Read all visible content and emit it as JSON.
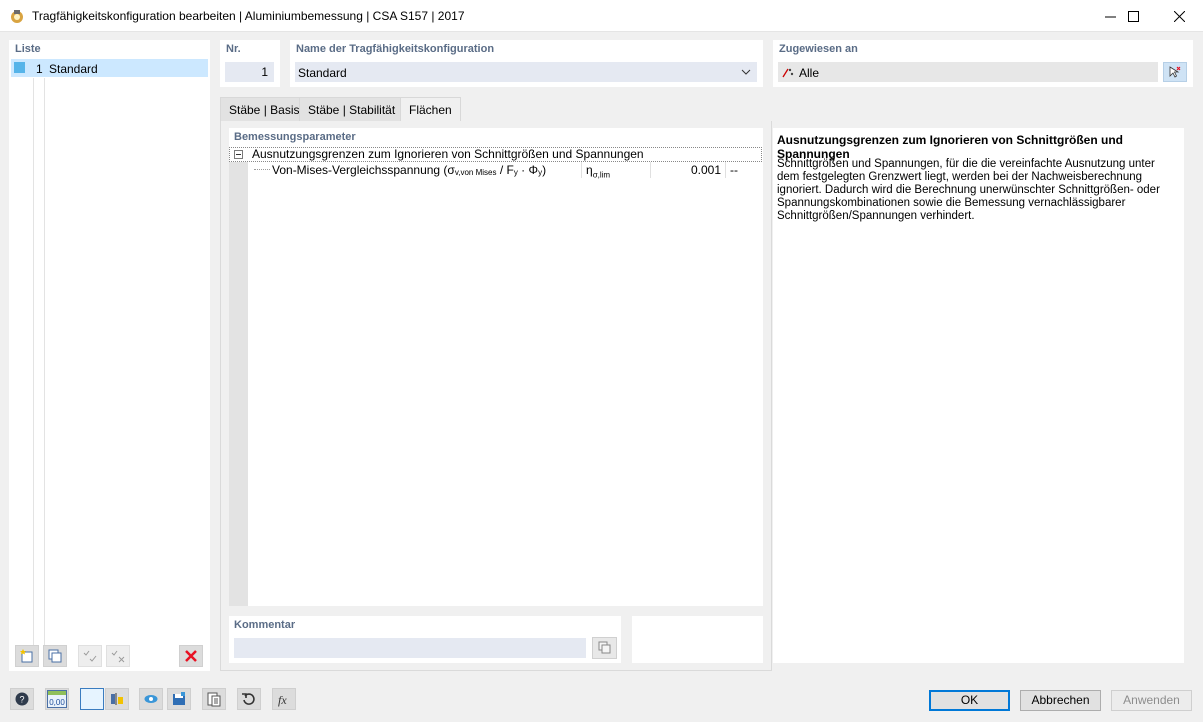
{
  "window": {
    "title": "Tragfähigkeitskonfiguration bearbeiten | Aluminiumbemessung | CSA S157 | 2017",
    "icons": [
      "app-icon",
      "minimize-icon",
      "maximize-icon",
      "close-icon"
    ]
  },
  "list": {
    "title": "Liste",
    "items": [
      {
        "number": "1",
        "name": "Standard"
      }
    ]
  },
  "header": {
    "nr_label": "Nr.",
    "nr_value": "1",
    "name_label": "Name der Tragfähigkeitskonfiguration",
    "name_value": "Standard",
    "assigned_label": "Zugewiesen an",
    "assigned_value": "Alle"
  },
  "tabs": [
    {
      "label": "Stäbe | Basis",
      "active": false
    },
    {
      "label": "Stäbe | Stabilität",
      "active": false
    },
    {
      "label": "Flächen",
      "active": true
    }
  ],
  "params": {
    "title": "Bemessungsparameter",
    "group": "Ausnutzungsgrenzen zum Ignorieren von Schnittgrößen und Spannungen",
    "row": {
      "label_prefix": "Von-Mises-Vergleichsspannung (σ",
      "label_sub1": "v,von Mises",
      "label_mid": " / F",
      "label_sub2": "y",
      "label_mid2": " · Φ",
      "label_sub3": "y",
      "label_suffix": ")",
      "symbol": "η",
      "symbol_sub": "σ,lim",
      "value": "0.001",
      "unit": "--"
    }
  },
  "comment": {
    "title": "Kommentar",
    "value": ""
  },
  "info": {
    "title": "Ausnutzungsgrenzen zum Ignorieren von Schnittgrößen und Spannungen",
    "text": "Schnittgrößen und Spannungen, für die die vereinfachte Ausnutzung unter dem festgelegten Grenzwert liegt, werden bei der Nachweisberechnung ignoriert. Dadurch wird die Berechnung unerwünschter Schnittgrößen- oder Spannungskombinationen sowie die Bemessung vernachlässigbarer Schnittgrößen/Spannungen verhindert."
  },
  "buttons": {
    "ok": "OK",
    "cancel": "Abbrechen",
    "apply": "Anwenden"
  },
  "bottom_toolbar": {
    "units_label": "0,00"
  },
  "colors": {
    "section_title": "#5a6c86",
    "selection": "#cce8ff",
    "accent": "#0078d7",
    "delete": "#e81123"
  }
}
